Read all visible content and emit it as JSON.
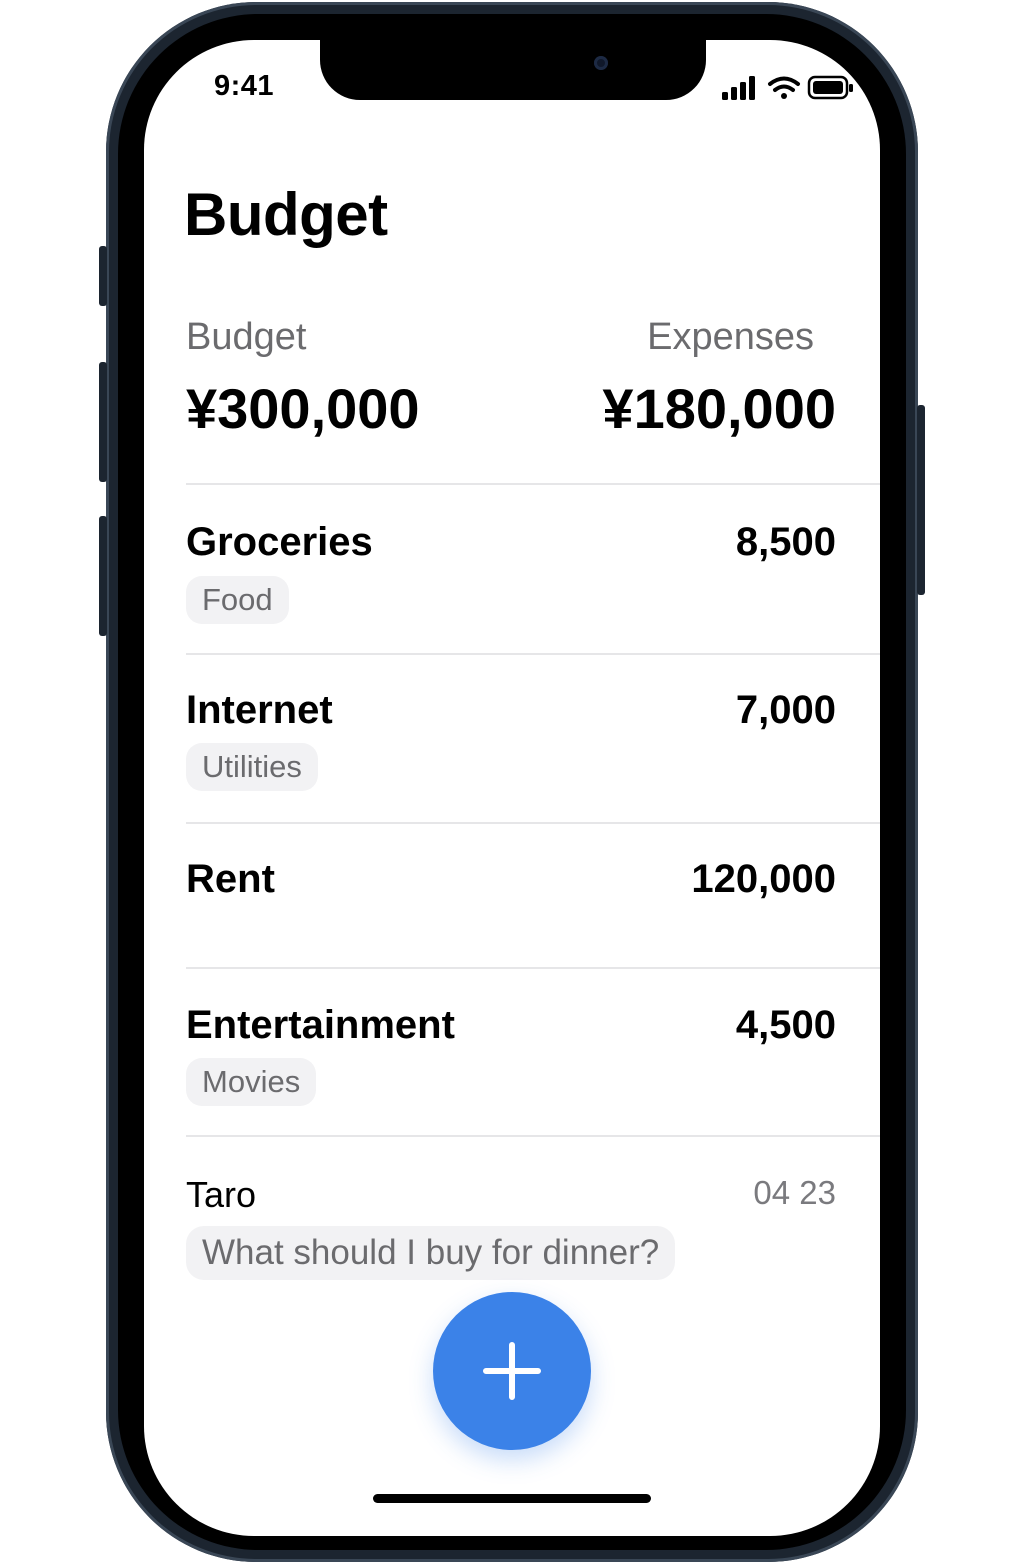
{
  "status_bar": {
    "time": "9:41",
    "icons": [
      "cellular-signal-icon",
      "wifi-icon",
      "battery-icon"
    ]
  },
  "header": {
    "title": "Budget"
  },
  "summary": {
    "budget_label": "Budget",
    "budget_value": "¥300,000",
    "expenses_label": "Expenses",
    "expenses_value": "¥180,000"
  },
  "expenses": [
    {
      "name": "Groceries",
      "amount": "8,500",
      "tag": "Food"
    },
    {
      "name": "Internet",
      "amount": "7,000",
      "tag": "Utilities"
    },
    {
      "name": "Rent",
      "amount": "120,000",
      "tag": ""
    },
    {
      "name": "Entertainment",
      "amount": "4,500",
      "tag": "Movies"
    }
  ],
  "message": {
    "sender": "Taro",
    "time": "04 23",
    "text": "What should I buy for dinner?"
  },
  "fab": {
    "icon": "plus-icon"
  },
  "colors": {
    "accent": "#3b82e8",
    "tag_background": "#f2f2f4",
    "secondary_text": "#6b6b6e",
    "divider": "#e6e6e8"
  }
}
